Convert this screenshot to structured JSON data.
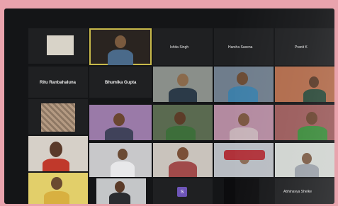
{
  "window": {
    "title": ""
  },
  "participants": {
    "top_left_label": "",
    "row1": [
      "Ishita Singh",
      "Harsha Saxena",
      "Pranit K"
    ],
    "row2": [
      "Ritu Ranbahaluna",
      "Bhumika Gupta"
    ],
    "bottom_name": "Abhinavya Shelke"
  },
  "avatar_initial": "S",
  "colors": {
    "active_speaker_border": "#c8b94a",
    "avatar_bg": "#6e55b8"
  }
}
